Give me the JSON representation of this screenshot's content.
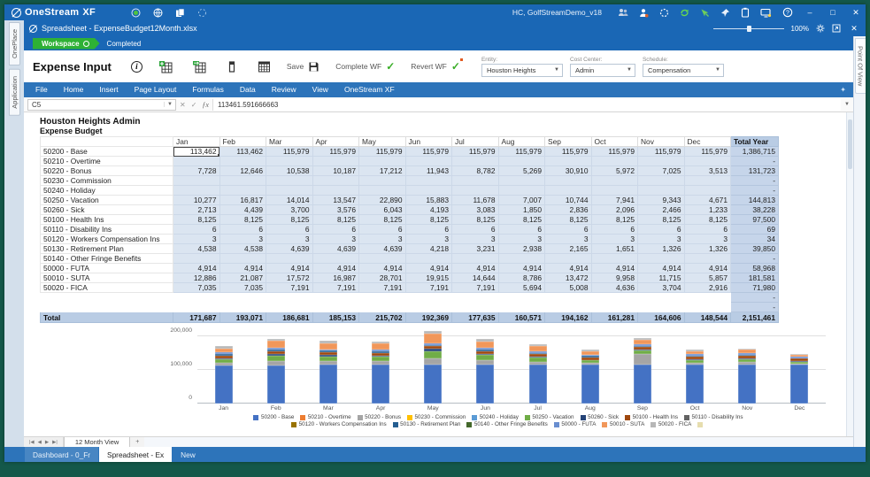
{
  "colors": {
    "brand_blue": "#1a67b5",
    "ribbon_blue": "#2d74ba",
    "workflow_green": "#2eb135",
    "frame_green": "#14584a",
    "cell_fill": "#dbe5f1",
    "total_col_fill": "#c6d5ea",
    "total_row_fill": "#b9cce4"
  },
  "title_bar": {
    "app_title": "OneStream",
    "app_suffix": "XF",
    "user_context": "HC, GolfStreamDemo_v18",
    "minimize": "–",
    "maximize": "□",
    "close": "✕"
  },
  "doc_bar": {
    "title": "Spreadsheet - ExpenseBudget12Month.xlsx",
    "zoom_level": "100%",
    "close": "✕"
  },
  "workflow_bar": {
    "badge": "Workspace",
    "status": "Completed"
  },
  "side_tabs": {
    "tab1": "OnePlace",
    "tab2": "Application"
  },
  "pov_tab": "Point Of View",
  "toolbar": {
    "title": "Expense Input",
    "info": "i",
    "save_label": "Save",
    "complete_label": "Complete WF",
    "revert_label": "Revert WF",
    "filters": [
      {
        "label": "Entity:",
        "value": "Houston Heights"
      },
      {
        "label": "Cost Center:",
        "value": "Admin"
      },
      {
        "label": "Schedule:",
        "value": "Compensation"
      }
    ]
  },
  "ribbon": {
    "tabs": [
      "File",
      "Home",
      "Insert",
      "Page Layout",
      "Formulas",
      "Data",
      "Review",
      "View",
      "OneStream XF"
    ]
  },
  "formula_bar": {
    "cell_ref": "C5",
    "value": "113461.591666663",
    "fx": "ƒx"
  },
  "sheet": {
    "title1": "Houston Heights Admin",
    "title2": "Expense Budget",
    "columns": [
      "Jan",
      "Feb",
      "Mar",
      "Apr",
      "May",
      "Jun",
      "Jul",
      "Aug",
      "Sep",
      "Oct",
      "Nov",
      "Dec"
    ],
    "total_col": "Total Year",
    "selected": {
      "row": 0,
      "col": 0
    },
    "rows": [
      {
        "label": "50200 - Base",
        "values": [
          "113,462",
          "113,462",
          "115,979",
          "115,979",
          "115,979",
          "115,979",
          "115,979",
          "115,979",
          "115,979",
          "115,979",
          "115,979",
          "115,979"
        ],
        "total": "1,386,715"
      },
      {
        "label": "50210 - Overtime",
        "values": [
          "",
          "",
          "",
          "",
          "",
          "",
          "",
          "",
          "",
          "",
          "",
          ""
        ],
        "total": "-"
      },
      {
        "label": "50220 - Bonus",
        "values": [
          "7,728",
          "12,646",
          "10,538",
          "10,187",
          "17,212",
          "11,943",
          "8,782",
          "5,269",
          "30,910",
          "5,972",
          "7,025",
          "3,513"
        ],
        "total": "131,723"
      },
      {
        "label": "50230 - Commission",
        "values": [
          "",
          "",
          "",
          "",
          "",
          "",
          "",
          "",
          "",
          "",
          "",
          ""
        ],
        "total": "-"
      },
      {
        "label": "50240 - Holiday",
        "values": [
          "",
          "",
          "",
          "",
          "",
          "",
          "",
          "",
          "",
          "",
          "",
          ""
        ],
        "total": "-"
      },
      {
        "label": "50250 - Vacation",
        "values": [
          "10,277",
          "16,817",
          "14,014",
          "13,547",
          "22,890",
          "15,883",
          "11,678",
          "7,007",
          "10,744",
          "7,941",
          "9,343",
          "4,671"
        ],
        "total": "144,813"
      },
      {
        "label": "50260 - Sick",
        "values": [
          "2,713",
          "4,439",
          "3,700",
          "3,576",
          "6,043",
          "4,193",
          "3,083",
          "1,850",
          "2,836",
          "2,096",
          "2,466",
          "1,233"
        ],
        "total": "38,228"
      },
      {
        "label": "50100 - Health Ins",
        "values": [
          "8,125",
          "8,125",
          "8,125",
          "8,125",
          "8,125",
          "8,125",
          "8,125",
          "8,125",
          "8,125",
          "8,125",
          "8,125",
          "8,125"
        ],
        "total": "97,500"
      },
      {
        "label": "50110 - Disability Ins",
        "values": [
          "6",
          "6",
          "6",
          "6",
          "6",
          "6",
          "6",
          "6",
          "6",
          "6",
          "6",
          "6"
        ],
        "total": "69"
      },
      {
        "label": "50120 - Workers Compensation Ins",
        "values": [
          "3",
          "3",
          "3",
          "3",
          "3",
          "3",
          "3",
          "3",
          "3",
          "3",
          "3",
          "3"
        ],
        "total": "34"
      },
      {
        "label": "50130 - Retirement Plan",
        "values": [
          "4,538",
          "4,538",
          "4,639",
          "4,639",
          "4,639",
          "4,218",
          "3,231",
          "2,938",
          "2,165",
          "1,651",
          "1,326",
          "1,326"
        ],
        "total": "39,850"
      },
      {
        "label": "50140 - Other Fringe Benefits",
        "values": [
          "",
          "",
          "",
          "",
          "",
          "",
          "",
          "",
          "",
          "",
          "",
          ""
        ],
        "total": "-"
      },
      {
        "label": "50000 - FUTA",
        "values": [
          "4,914",
          "4,914",
          "4,914",
          "4,914",
          "4,914",
          "4,914",
          "4,914",
          "4,914",
          "4,914",
          "4,914",
          "4,914",
          "4,914"
        ],
        "total": "58,968"
      },
      {
        "label": "50010 - SUTA",
        "values": [
          "12,886",
          "21,087",
          "17,572",
          "16,987",
          "28,701",
          "19,915",
          "14,644",
          "8,786",
          "13,472",
          "9,958",
          "11,715",
          "5,857"
        ],
        "total": "181,581"
      },
      {
        "label": "50020 - FICA",
        "values": [
          "7,035",
          "7,035",
          "7,191",
          "7,191",
          "7,191",
          "7,191",
          "7,191",
          "5,694",
          "5,008",
          "4,636",
          "3,704",
          "2,916"
        ],
        "total": "71,980"
      },
      {
        "label": "",
        "spacer": true,
        "values": [
          "",
          "",
          "",
          "",
          "",
          "",
          "",
          "",
          "",
          "",
          "",
          ""
        ],
        "total": "-"
      },
      {
        "label": "",
        "spacer": true,
        "values": [
          "",
          "",
          "",
          "",
          "",
          "",
          "",
          "",
          "",
          "",
          "",
          ""
        ],
        "total": "-"
      }
    ],
    "total_row": {
      "label": "Total",
      "values": [
        "171,687",
        "193,071",
        "186,681",
        "185,153",
        "215,702",
        "192,369",
        "177,635",
        "160,571",
        "194,162",
        "161,281",
        "164,606",
        "148,544"
      ],
      "total": "2,151,461"
    }
  },
  "chart_data": {
    "type": "bar",
    "stacked": true,
    "categories": [
      "Jan",
      "Feb",
      "Mar",
      "Apr",
      "May",
      "Jun",
      "Jul",
      "Aug",
      "Sep",
      "Oct",
      "Nov",
      "Dec"
    ],
    "yticks": [
      "200,000",
      "100,000",
      "0"
    ],
    "ylim": [
      0,
      200000
    ],
    "grid": true,
    "legend_position": "bottom",
    "series": [
      {
        "name": "50200 - Base",
        "color": "#4472C4",
        "values": [
          113462,
          113462,
          115979,
          115979,
          115979,
          115979,
          115979,
          115979,
          115979,
          115979,
          115979,
          115979
        ]
      },
      {
        "name": "50210 - Overtime",
        "color": "#ED7D31",
        "values": [
          0,
          0,
          0,
          0,
          0,
          0,
          0,
          0,
          0,
          0,
          0,
          0
        ]
      },
      {
        "name": "50220 - Bonus",
        "color": "#A5A5A5",
        "values": [
          7728,
          12646,
          10538,
          10187,
          17212,
          11943,
          8782,
          5269,
          30910,
          5972,
          7025,
          3513
        ]
      },
      {
        "name": "50230 - Commission",
        "color": "#FFC000",
        "values": [
          0,
          0,
          0,
          0,
          0,
          0,
          0,
          0,
          0,
          0,
          0,
          0
        ]
      },
      {
        "name": "50240 - Holiday",
        "color": "#5B9BD5",
        "values": [
          0,
          0,
          0,
          0,
          0,
          0,
          0,
          0,
          0,
          0,
          0,
          0
        ]
      },
      {
        "name": "50250 - Vacation",
        "color": "#70AD47",
        "values": [
          10277,
          16817,
          14014,
          13547,
          22890,
          15883,
          11678,
          7007,
          10744,
          7941,
          9343,
          4671
        ]
      },
      {
        "name": "50260 - Sick",
        "color": "#264478",
        "values": [
          2713,
          4439,
          3700,
          3576,
          6043,
          4193,
          3083,
          1850,
          2836,
          2096,
          2466,
          1233
        ]
      },
      {
        "name": "50100 - Health Ins",
        "color": "#9E480E",
        "values": [
          8125,
          8125,
          8125,
          8125,
          8125,
          8125,
          8125,
          8125,
          8125,
          8125,
          8125,
          8125
        ]
      },
      {
        "name": "50110 - Disability Ins",
        "color": "#636363",
        "values": [
          6,
          6,
          6,
          6,
          6,
          6,
          6,
          6,
          6,
          6,
          6,
          6
        ]
      },
      {
        "name": "50120 - Workers Compensation Ins",
        "color": "#997300",
        "values": [
          3,
          3,
          3,
          3,
          3,
          3,
          3,
          3,
          3,
          3,
          3,
          3
        ]
      },
      {
        "name": "50130 - Retirement Plan",
        "color": "#255E91",
        "values": [
          4538,
          4538,
          4639,
          4639,
          4639,
          4218,
          3231,
          2938,
          2165,
          1651,
          1326,
          1326
        ]
      },
      {
        "name": "50140 - Other Fringe Benefits",
        "color": "#43682B",
        "values": [
          0,
          0,
          0,
          0,
          0,
          0,
          0,
          0,
          0,
          0,
          0,
          0
        ]
      },
      {
        "name": "50000 - FUTA",
        "color": "#698ED0",
        "values": [
          4914,
          4914,
          4914,
          4914,
          4914,
          4914,
          4914,
          4914,
          4914,
          4914,
          4914,
          4914
        ]
      },
      {
        "name": "50010 - SUTA",
        "color": "#F1975A",
        "values": [
          12886,
          21087,
          17572,
          16987,
          28701,
          19915,
          14644,
          8786,
          13472,
          9958,
          11715,
          5857
        ]
      },
      {
        "name": "50020 - FICA",
        "color": "#B7B7B7",
        "values": [
          7035,
          7035,
          7191,
          7191,
          7191,
          7191,
          7191,
          5694,
          5008,
          4636,
          3704,
          2916
        ]
      }
    ],
    "extra_legend_swatch": {
      "color": "#E6DDAE",
      "label": ""
    }
  },
  "sheet_nav": {
    "first": "|◀",
    "prev": "◀",
    "next": "▶",
    "last": "▶|",
    "tab": "12 Month View",
    "add": "+"
  },
  "bottom_tabs": [
    {
      "label": "Dashboard - 0_Fr",
      "active": false
    },
    {
      "label": "Spreadsheet - Ex",
      "active": true
    },
    {
      "label": "New",
      "active": false
    }
  ]
}
